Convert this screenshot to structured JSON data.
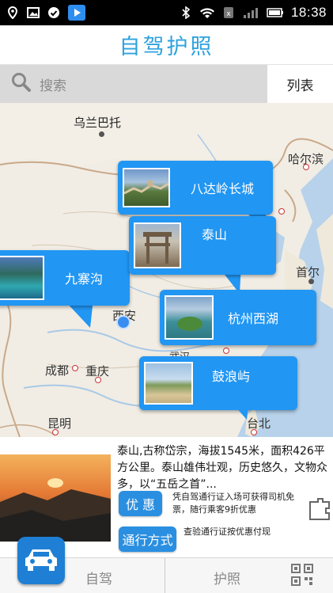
{
  "statusbar": {
    "time": "18:38",
    "left_icons": [
      "location-icon",
      "image-icon",
      "check-circle-icon",
      "play-store-icon"
    ],
    "right_icons": [
      "bluetooth-icon",
      "wifi-icon",
      "signal-icon",
      "battery-icon"
    ]
  },
  "header": {
    "title": "自驾护照"
  },
  "search": {
    "placeholder": "搜索",
    "list_label": "列表"
  },
  "map": {
    "cities": [
      {
        "name": "乌兰巴托"
      },
      {
        "name": "哈尔滨"
      },
      {
        "name": "首尔"
      },
      {
        "name": "西安"
      },
      {
        "name": "成都"
      },
      {
        "name": "重庆"
      },
      {
        "name": "昆明"
      },
      {
        "name": "台北"
      },
      {
        "name": "武汉"
      }
    ],
    "spots": [
      {
        "name": "八达岭长城",
        "thumb": "great-wall-photo"
      },
      {
        "name": "泰山",
        "thumb": "mount-tai-gate-photo"
      },
      {
        "name": "九寨沟",
        "thumb": "jiuzhaigou-lake-photo"
      },
      {
        "name": "杭州西湖",
        "thumb": "west-lake-photo"
      },
      {
        "name": "鼓浪屿",
        "thumb": "gulangyu-beach-photo"
      }
    ]
  },
  "info": {
    "description": "泰山,古称岱宗，海拔1545米，面积426平方公里。泰山雄伟壮观，历史悠久，文物众多，以“五岳之首”...",
    "discount_label": "优 惠",
    "discount_note": "凭自驾通行证入场可获得司机免票，随行乘客9折优惠",
    "access_label": "通行方式",
    "access_note": "查验通行证按优惠付现"
  },
  "tabbar": {
    "tab1": "自驾",
    "tab2": "护照"
  },
  "colors": {
    "accent": "#2ea2de",
    "bubble": "#2196f3",
    "button": "#2a8fe0"
  }
}
